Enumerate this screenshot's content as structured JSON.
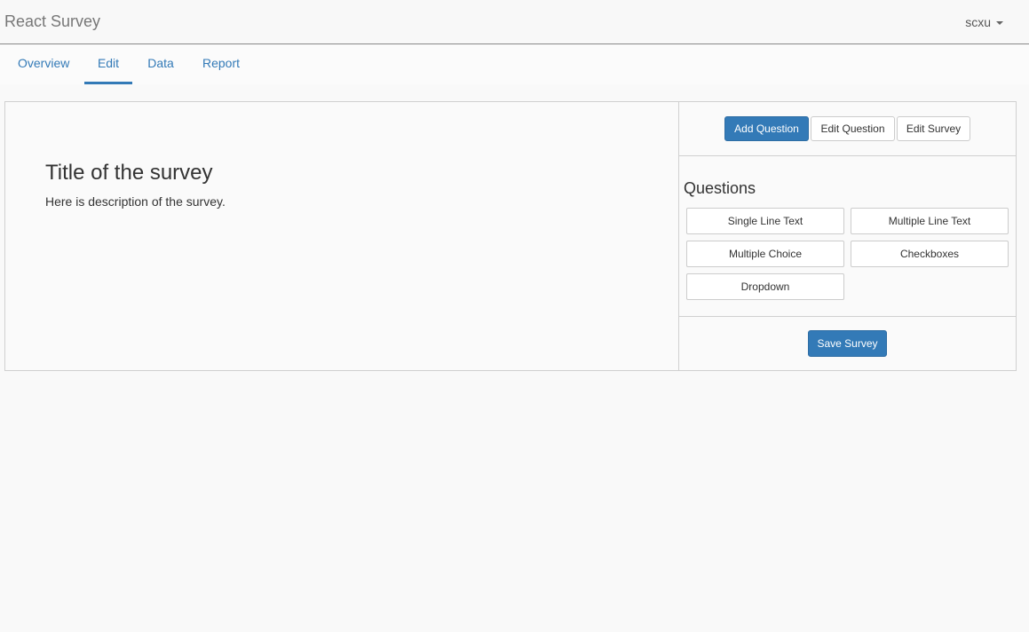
{
  "navbar": {
    "brand": "React Survey",
    "user": "scxu"
  },
  "tabs": [
    {
      "label": "Overview",
      "active": false
    },
    {
      "label": "Edit",
      "active": true
    },
    {
      "label": "Data",
      "active": false
    },
    {
      "label": "Report",
      "active": false
    }
  ],
  "survey": {
    "title": "Title of the survey",
    "description": "Here is description of the survey."
  },
  "sidebar": {
    "modes": [
      {
        "label": "Add Question",
        "active": true
      },
      {
        "label": "Edit Question",
        "active": false
      },
      {
        "label": "Edit Survey",
        "active": false
      }
    ],
    "questions_heading": "Questions",
    "question_types": [
      "Single Line Text",
      "Multiple Line Text",
      "Multiple Choice",
      "Checkboxes",
      "Dropdown"
    ],
    "save_label": "Save Survey"
  },
  "colors": {
    "accent": "#337ab7",
    "border": "#d0d0d0"
  }
}
